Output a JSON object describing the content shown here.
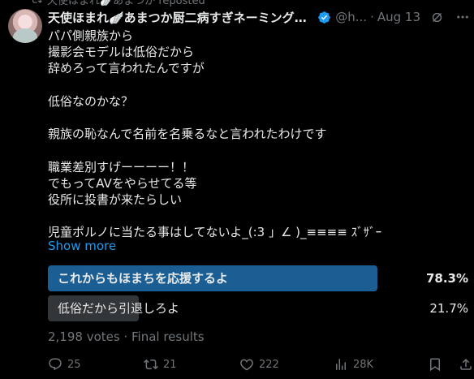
{
  "repost": {
    "text": "天使ほまれ🪽あまつか reposted"
  },
  "tweet": {
    "display_name": "天使ほまれ🪽あまつか厨二病すぎネーミングにな...",
    "handle": "@h...",
    "separator": "·",
    "date": "Aug 13",
    "body_lines": [
      "パパ側親族から",
      "撮影会モデルは低俗だから",
      "辞めろって言われたんですが",
      "",
      "低俗なのかな？",
      "",
      "親族の恥なんで名前を名乗るなと言われたわけです",
      "",
      "職業差別すげーーーー！！",
      "でもってAVをやらせてる等",
      "役所に投書が来たらしい",
      "",
      "児童ポルノに当たる事はしてないよ_(:3 」∠ )_≡≡≡≡ ｽﾞｻﾞｰ"
    ],
    "show_more": "Show more"
  },
  "poll": {
    "options": [
      {
        "label": "これからもほまちを応援するよ",
        "percent": "78.3%",
        "fraction": 0.783,
        "winner": true
      },
      {
        "label": "低俗だから引退しろよ",
        "percent": "21.7%",
        "fraction": 0.217,
        "winner": false
      }
    ],
    "footer": "2,198 votes · Final results"
  },
  "actions": {
    "replies": "25",
    "reposts": "21",
    "likes": "222",
    "views": "28K"
  },
  "colors": {
    "background": "#000000",
    "text": "#e7e9ea",
    "muted": "#71767b",
    "link": "#1d9bf0",
    "poll_winner": "#1a5e94",
    "poll_other": "#333639",
    "verified": "#1d9bf0"
  },
  "icons": {
    "repost_header": "repost-icon",
    "verified": "verified-badge-icon",
    "grok": "grok-icon",
    "more": "more-icon",
    "reply": "reply-icon",
    "repost": "repost-icon",
    "like": "heart-icon",
    "views": "views-icon",
    "bookmark": "bookmark-icon"
  }
}
